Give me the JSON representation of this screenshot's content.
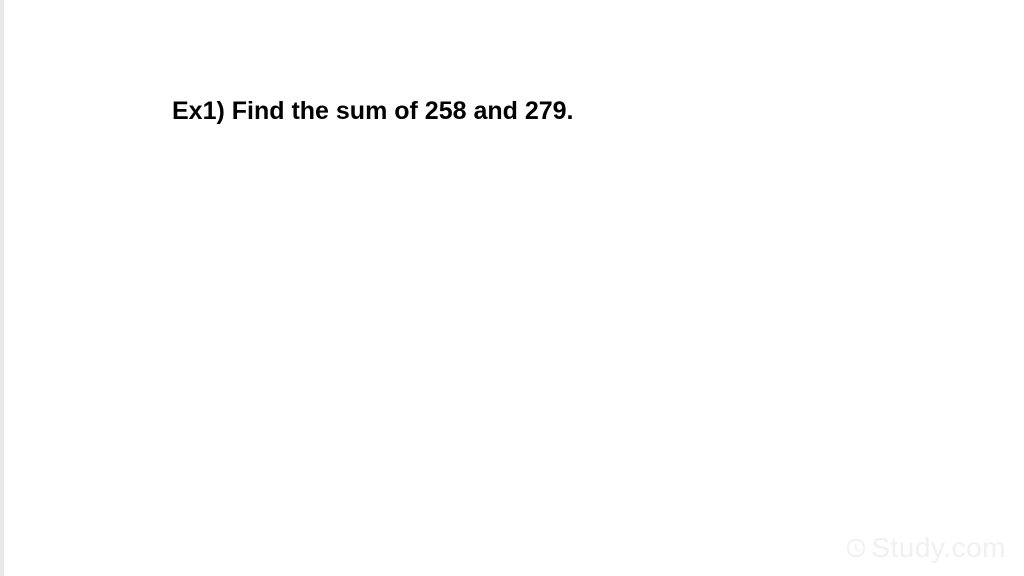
{
  "content": {
    "problem_text": "Ex1) Find the sum of 258 and 279."
  },
  "watermark": {
    "brand": "Study.com"
  }
}
